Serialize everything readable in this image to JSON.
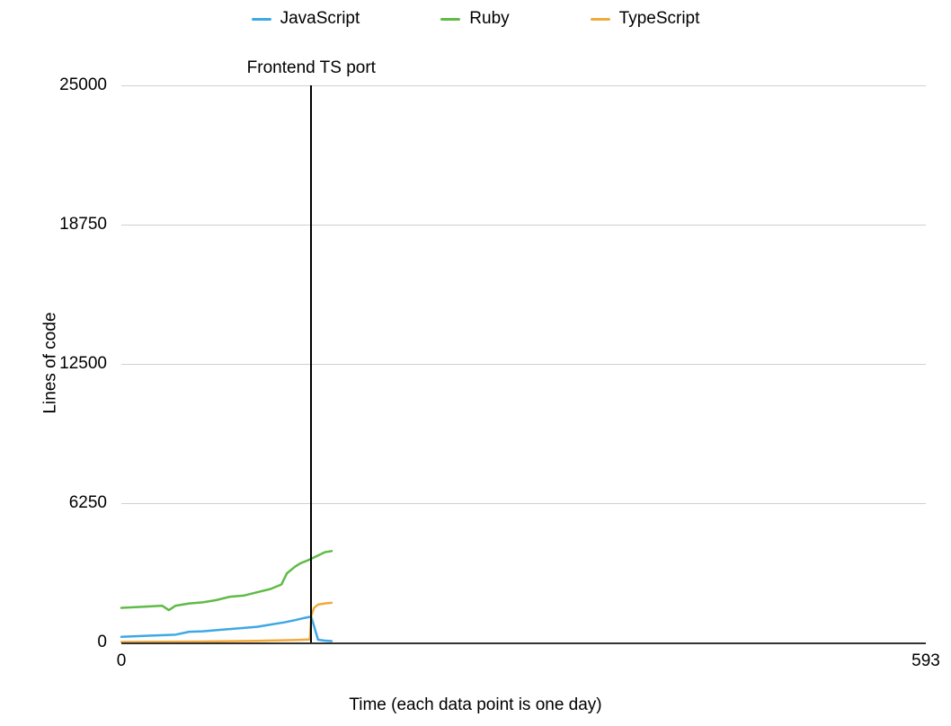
{
  "chart_data": {
    "type": "line",
    "title": "",
    "xlabel": "Time (each data point is one day)",
    "ylabel": "Lines of code",
    "xlim": [
      0,
      593
    ],
    "ylim": [
      0,
      25000
    ],
    "y_ticks": [
      0,
      6250,
      12500,
      18750,
      25000
    ],
    "x_ticks": [
      0,
      593
    ],
    "annotation": {
      "label": "Frontend TS port",
      "x": 140
    },
    "series": [
      {
        "name": "JavaScript",
        "color": "#3ea8e5",
        "x": [
          0,
          20,
          40,
          50,
          60,
          80,
          100,
          110,
          120,
          128,
          135,
          139,
          140,
          145,
          150,
          155
        ],
        "values": [
          250,
          300,
          350,
          480,
          500,
          600,
          700,
          800,
          900,
          1000,
          1100,
          1150,
          1150,
          120,
          80,
          60
        ]
      },
      {
        "name": "Ruby",
        "color": "#5fbb46",
        "x": [
          0,
          15,
          30,
          35,
          40,
          50,
          60,
          70,
          80,
          90,
          100,
          110,
          118,
          122,
          128,
          132,
          138,
          145,
          150,
          155
        ],
        "values": [
          1550,
          1600,
          1650,
          1450,
          1650,
          1750,
          1800,
          1900,
          2050,
          2100,
          2250,
          2400,
          2600,
          3100,
          3400,
          3550,
          3700,
          3900,
          4050,
          4100
        ]
      },
      {
        "name": "TypeScript",
        "color": "#f2a93b",
        "x": [
          0,
          60,
          100,
          130,
          138,
          139,
          140,
          142,
          145,
          150,
          155
        ],
        "values": [
          20,
          40,
          70,
          110,
          130,
          150,
          1200,
          1550,
          1700,
          1750,
          1780
        ]
      }
    ],
    "legend": [
      "JavaScript",
      "Ruby",
      "TypeScript"
    ]
  }
}
